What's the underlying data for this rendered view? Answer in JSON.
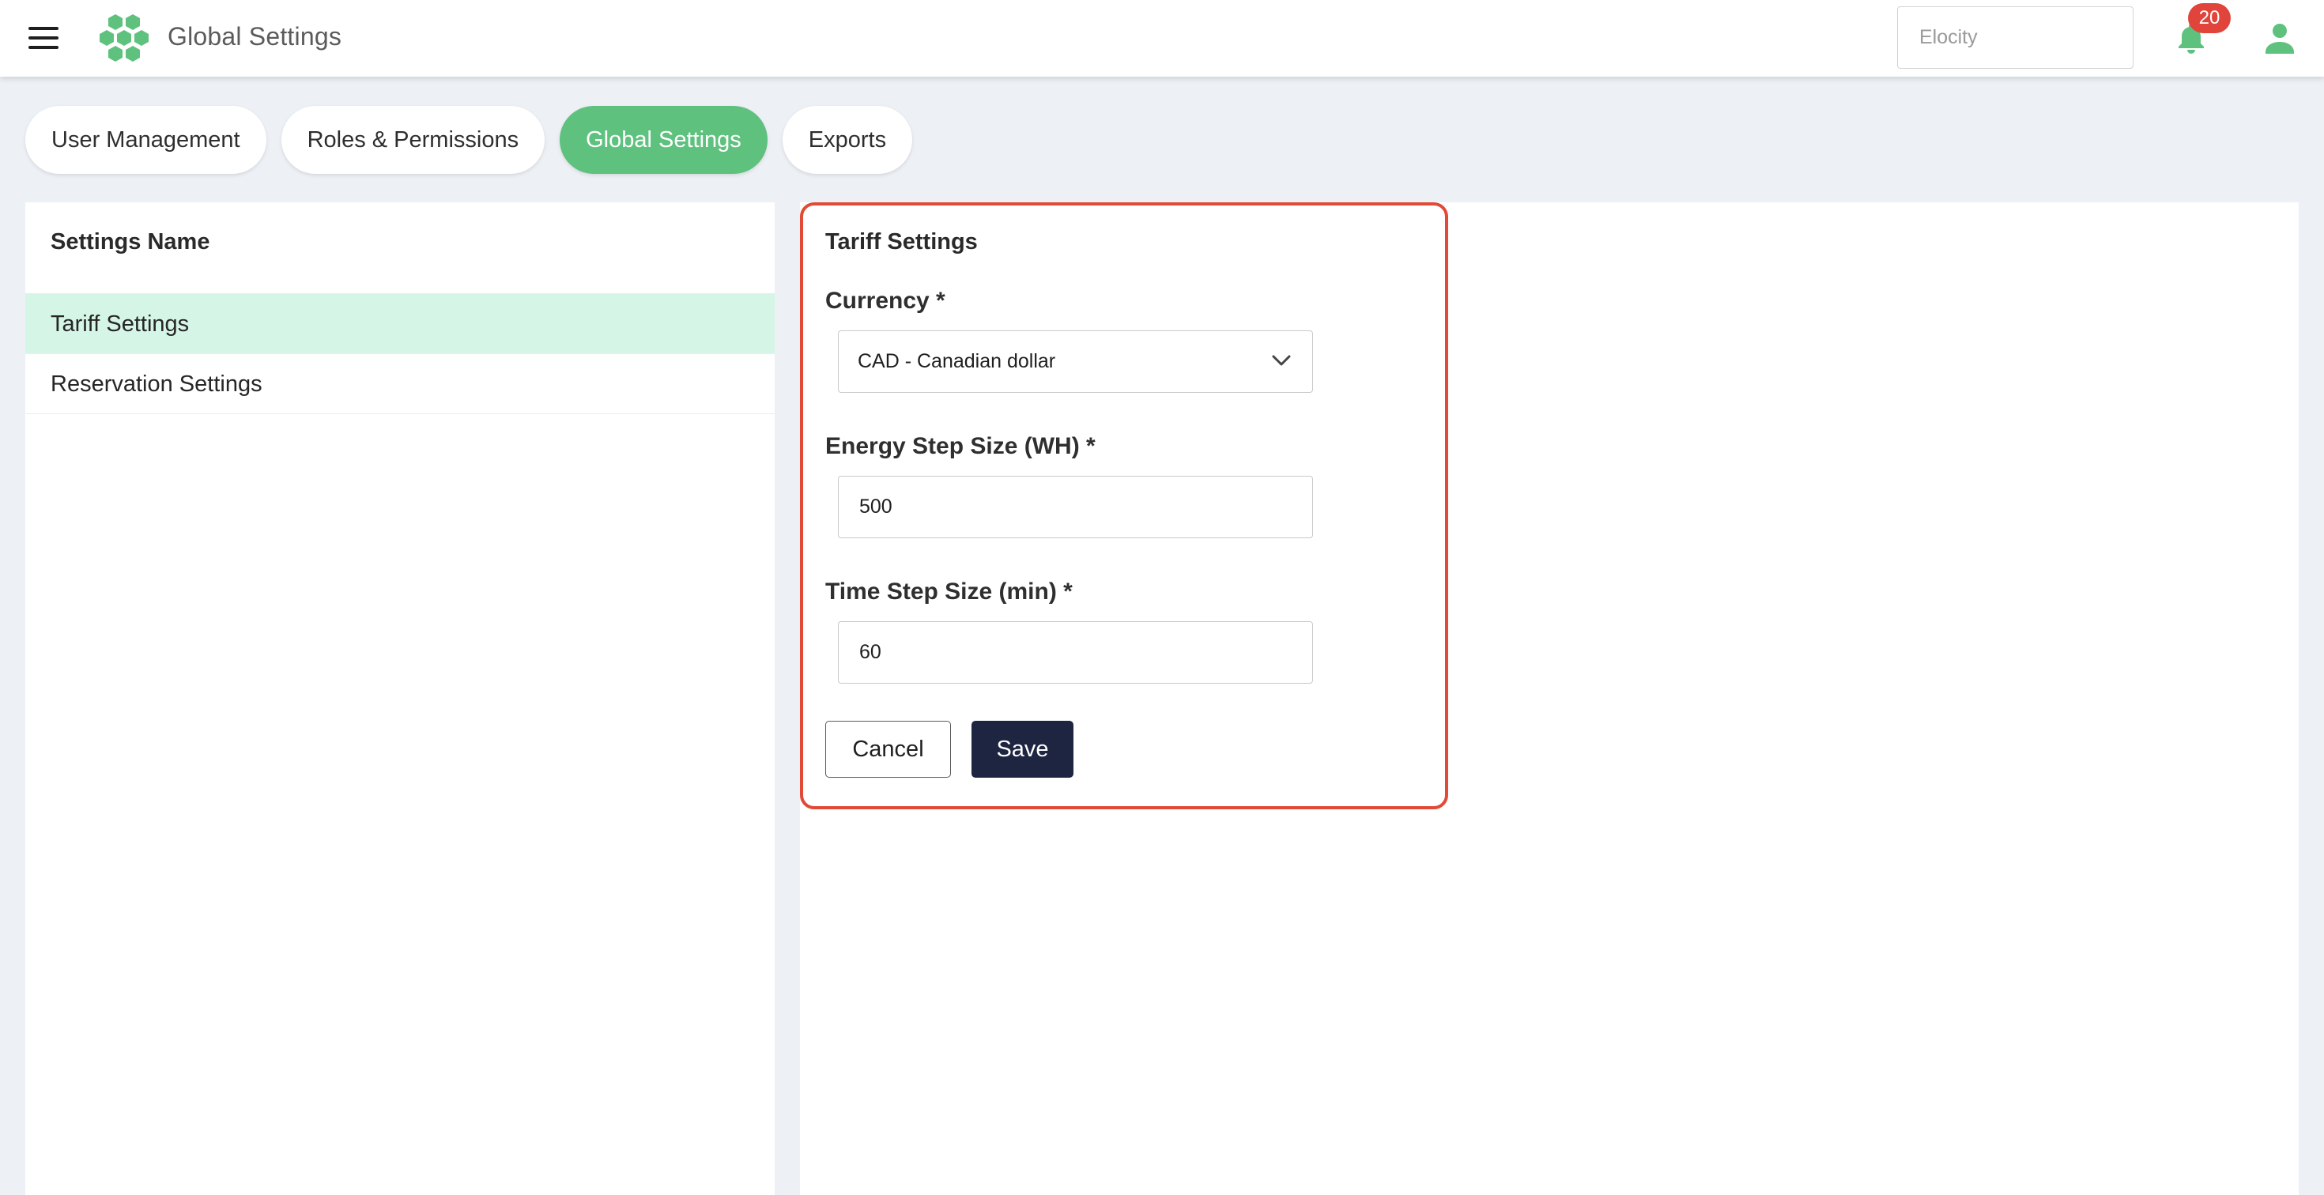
{
  "header": {
    "title": "Global Settings",
    "org_placeholder": "Elocity",
    "notification_count": "20",
    "brand_color": "#5ec27e",
    "badge_color": "#e0443a"
  },
  "tabs": [
    {
      "label": "User Management",
      "active": false
    },
    {
      "label": "Roles & Permissions",
      "active": false
    },
    {
      "label": "Global Settings",
      "active": true
    },
    {
      "label": "Exports",
      "active": false
    }
  ],
  "sidebar": {
    "header": "Settings Name",
    "items": [
      {
        "label": "Tariff Settings",
        "active": true
      },
      {
        "label": "Reservation Settings",
        "active": false
      }
    ]
  },
  "tariff": {
    "title": "Tariff Settings",
    "currency_label": "Currency *",
    "currency_value": "CAD - Canadian dollar",
    "energy_label": "Energy Step Size (WH) *",
    "energy_value": "500",
    "time_label": "Time Step Size (min) *",
    "time_value": "60",
    "cancel_label": "Cancel",
    "save_label": "Save",
    "highlight_color": "#e04a36"
  }
}
